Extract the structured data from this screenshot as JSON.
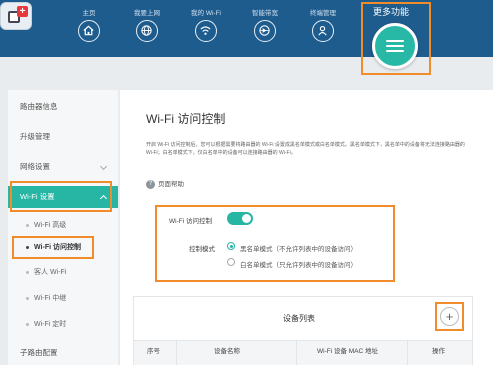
{
  "nav": {
    "items": [
      {
        "label": "主页",
        "icon": "home-icon"
      },
      {
        "label": "我要上网",
        "icon": "globe-icon"
      },
      {
        "label": "我的 Wi-Fi",
        "icon": "wifi-icon"
      },
      {
        "label": "智能带宽",
        "icon": "bandwidth-icon"
      },
      {
        "label": "终端管理",
        "icon": "user-icon"
      }
    ],
    "more_label": "更多功能"
  },
  "sidebar": {
    "items": [
      {
        "label": "路由器信息"
      },
      {
        "label": "升级管理"
      },
      {
        "label": "网络设置"
      },
      {
        "label": "Wi-Fi 设置"
      },
      {
        "label": "Wi-Fi 高级"
      },
      {
        "label": "Wi-Fi 访问控制"
      },
      {
        "label": "客人 Wi-Fi"
      },
      {
        "label": "Wi-Fi 中继"
      },
      {
        "label": "Wi-Fi 定时"
      },
      {
        "label": "子路由配置"
      }
    ]
  },
  "main": {
    "title": "Wi-Fi 访问控制",
    "description": "开启 Wi-Fi 访问控制后，您可以根据需要将路由器的 Wi-Fi 设置成黑名单模式或白名单模式。黑名单模式下，黑名单中的设备将无法连接路由器的 Wi-Fi；白名单模式下，仅白名单中的设备可以连接路由器的 Wi-Fi。",
    "help_label": "页面帮助",
    "toggle_label": "Wi-Fi 访问控制",
    "toggle_on": true,
    "mode_label": "控制模式",
    "mode_options": [
      "黑名单模式（不允许列表中的设备访问）",
      "白名单模式（只允许列表中的设备访问）"
    ],
    "mode_selected": 0
  },
  "device_list": {
    "title": "设备列表",
    "add_label": "+",
    "columns": [
      "序号",
      "设备名称",
      "Wi-Fi 设备 MAC 地址",
      "操作"
    ]
  },
  "colors": {
    "nav_bg": "#1f5c8e",
    "accent": "#26b6a3",
    "highlight": "#f08c2a"
  }
}
